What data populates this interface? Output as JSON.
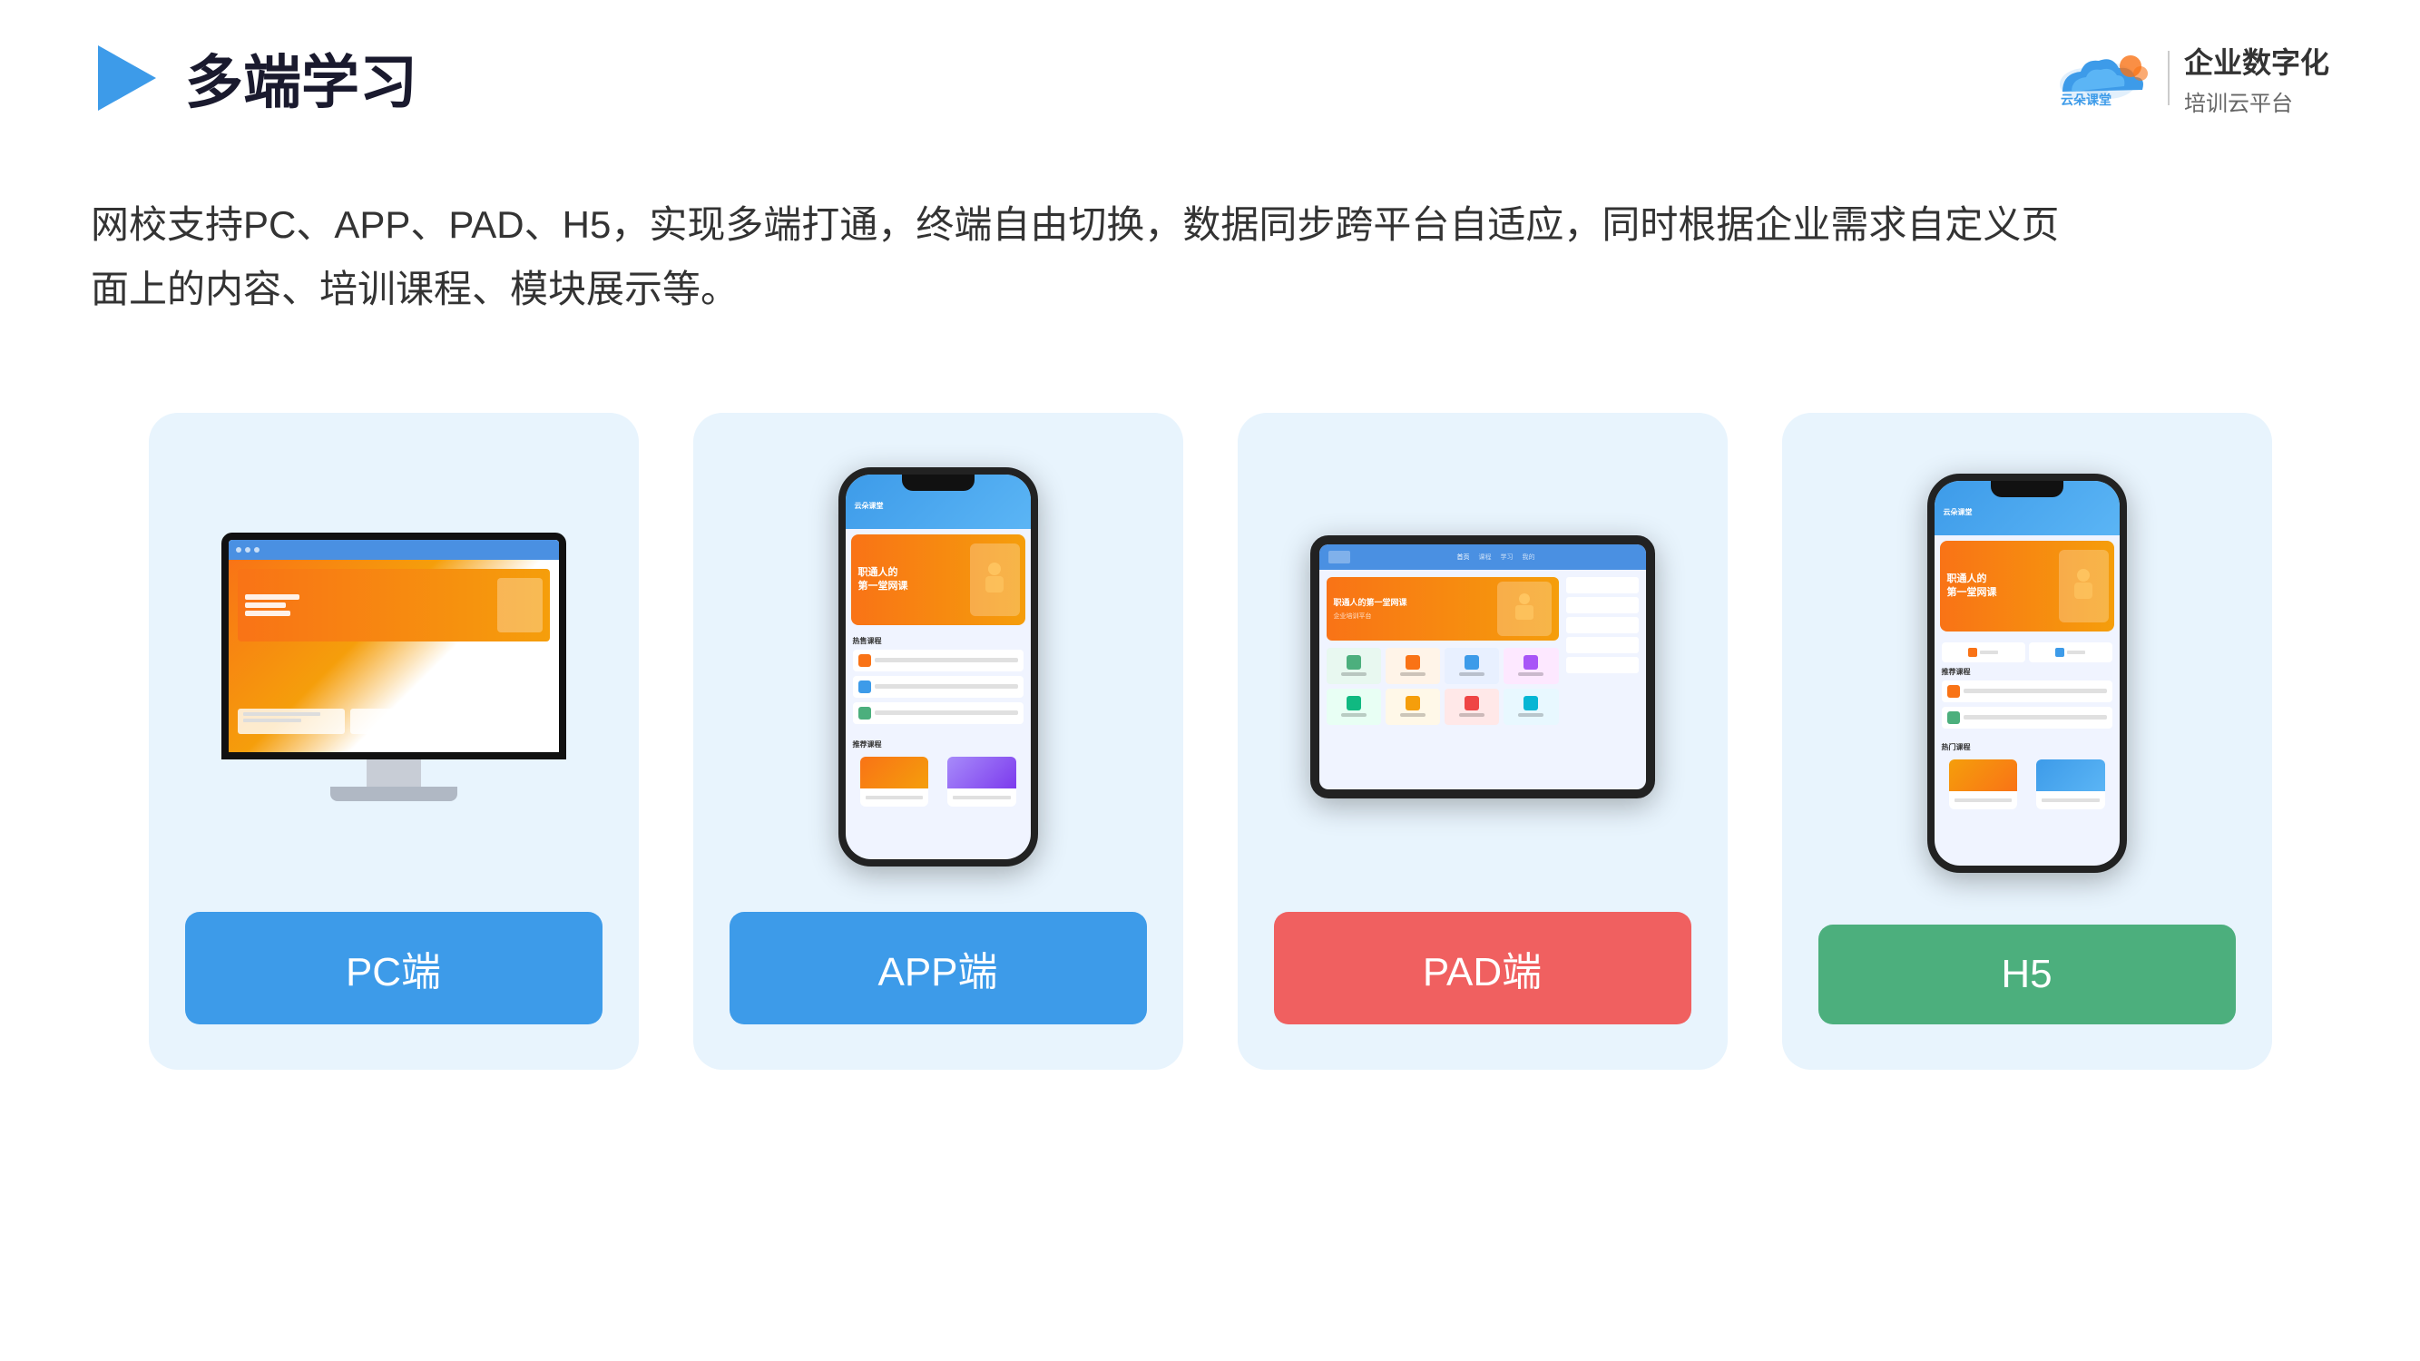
{
  "header": {
    "title": "多端学习",
    "logo_name": "云朵课堂",
    "logo_url": "yunduoketang.com",
    "tagline_top": "企业数字化",
    "tagline_bottom": "培训云平台"
  },
  "description": {
    "text": "网校支持PC、APP、PAD、H5，实现多端打通，终端自由切换，数据同步跨平台自适应，同时根据企业需求自定义页面上的内容、培训课程、模块展示等。"
  },
  "cards": [
    {
      "id": "pc",
      "label": "PC端",
      "color": "#3d9be9",
      "type": "pc"
    },
    {
      "id": "app",
      "label": "APP端",
      "color": "#3d9be9",
      "type": "phone"
    },
    {
      "id": "pad",
      "label": "PAD端",
      "color": "#f06060",
      "type": "pad"
    },
    {
      "id": "h5",
      "label": "H5",
      "color": "#4caf7d",
      "type": "phone"
    }
  ]
}
